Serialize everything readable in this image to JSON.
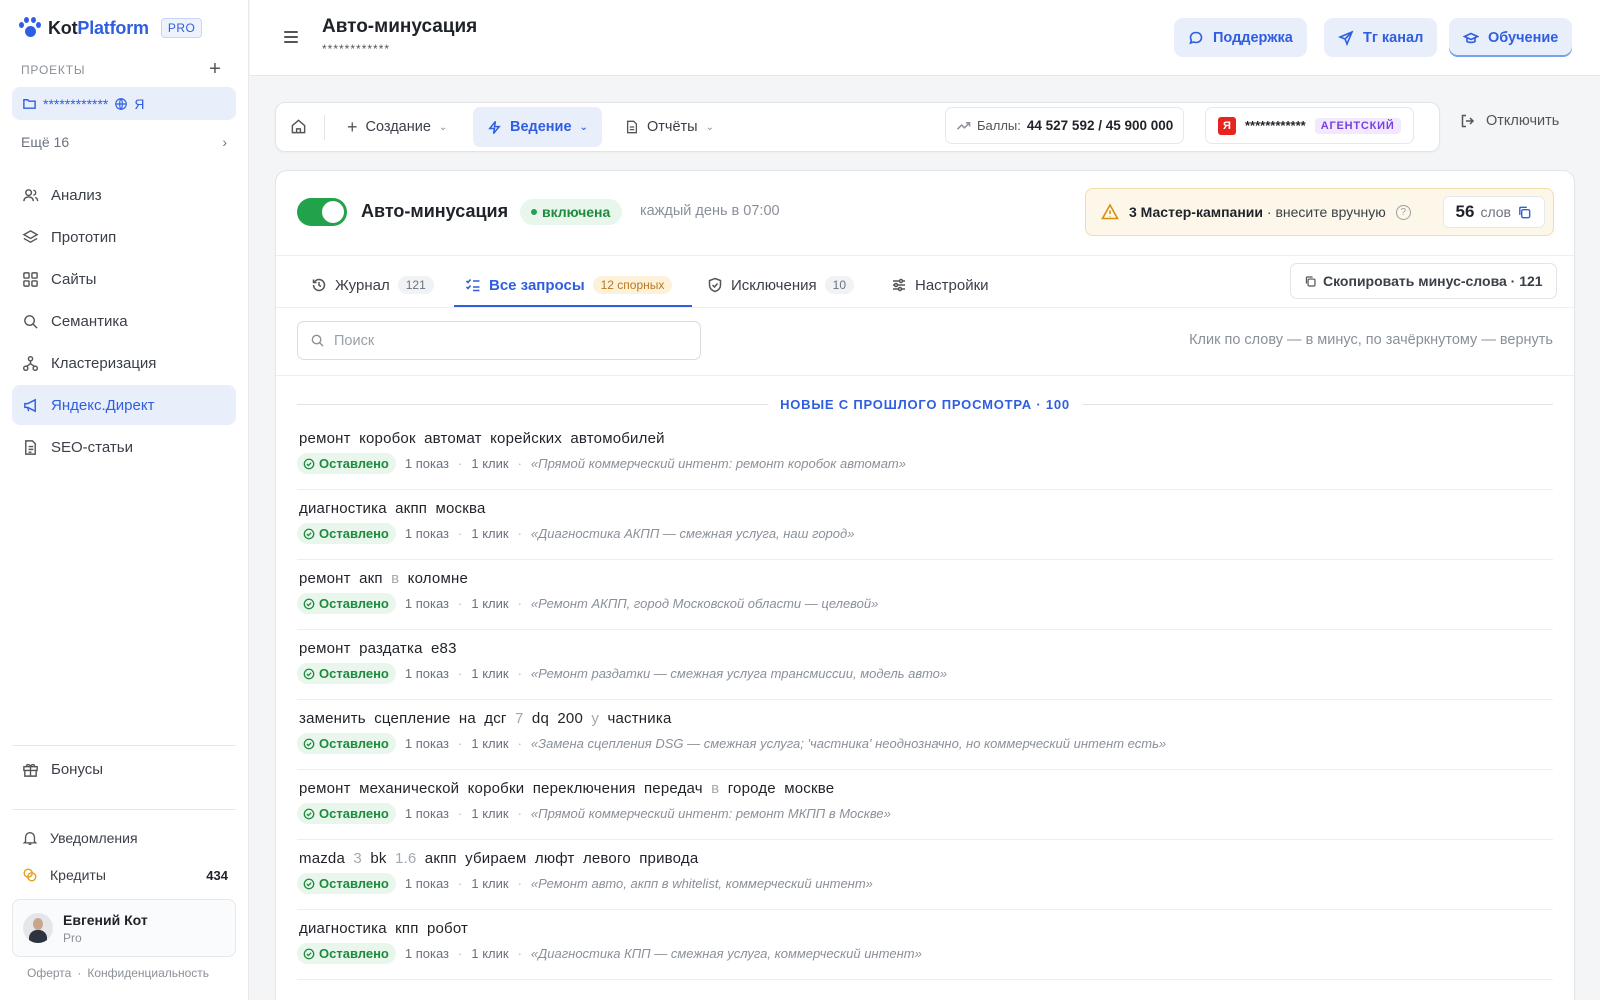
{
  "brand": {
    "name_part1": "Kot",
    "name_part2": "Platform",
    "badge": "PRO",
    "accent": "#2f5fe0"
  },
  "sidebar": {
    "section_label": "ПРОЕКТЫ",
    "add_symbol": "+",
    "project": {
      "name": "************",
      "suffix": "Я"
    },
    "more_label": "Ещё 16",
    "items": [
      {
        "label": "Анализ",
        "icon": "users-icon"
      },
      {
        "label": "Прототип",
        "icon": "layers-icon"
      },
      {
        "label": "Сайты",
        "icon": "grid-icon"
      },
      {
        "label": "Семантика",
        "icon": "search-icon"
      },
      {
        "label": "Кластеризация",
        "icon": "cluster-icon"
      },
      {
        "label": "Яндекс.Директ",
        "icon": "megaphone-icon",
        "active": true
      },
      {
        "label": "SEO-статьи",
        "icon": "document-icon"
      }
    ],
    "bonuses": "Бонусы",
    "notifications": "Уведомления",
    "credits_label": "Кредиты",
    "credits_count": "434",
    "user": {
      "name": "Евгений Кот",
      "plan": "Pro"
    },
    "legal": {
      "offer": "Оферта",
      "sep": "·",
      "privacy": "Конфиденциальность"
    }
  },
  "topbar": {
    "title": "Авто-минусация",
    "subtitle": "************",
    "buttons": {
      "support": "Поддержка",
      "telegram": "Тг канал",
      "learning": "Обучение"
    }
  },
  "toolbar": {
    "create": "Создание",
    "manage": "Ведение",
    "reports": "Отчёты",
    "points_label": "Баллы:",
    "points_value": "44 527 592 / 45 900 000",
    "account_name": "************",
    "account_badge": "АГЕНТСКИЙ",
    "ya_letter": "Я",
    "disconnect": "Отключить"
  },
  "feature": {
    "title": "Авто-минусация",
    "status": "включена",
    "schedule": "каждый день в 07:00",
    "warning_bold": "3 Мастер-кампании",
    "warning_rest": " · внесите вручную",
    "words_count": "56",
    "words_label": "слов",
    "toggle_on": true
  },
  "tabs": [
    {
      "label": "Журнал",
      "count": "121"
    },
    {
      "label": "Все запросы",
      "count": "12 спорных",
      "active": true
    },
    {
      "label": "Исключения",
      "count": "10"
    },
    {
      "label": "Настройки",
      "count": ""
    }
  ],
  "copy_button": "Скопировать минус-слова · 121",
  "search": {
    "placeholder": "Поиск"
  },
  "hint": "Клик по слову — в минус, по зачёркнутому — вернуть",
  "new_separator": "НОВЫЕ С ПРОШЛОГО ПРОСМОТРА · 100",
  "rows": [
    {
      "words": [
        [
          "ремонт",
          0
        ],
        [
          "коробок",
          0
        ],
        [
          "автомат",
          0
        ],
        [
          "корейских",
          0
        ],
        [
          "автомобилей",
          0
        ]
      ],
      "status": "Оставлено",
      "shows": "1 показ",
      "clicks": "1 клик",
      "reason": "«Прямой коммерческий интент: ремонт коробок автомат»"
    },
    {
      "words": [
        [
          "диагностика",
          0
        ],
        [
          "акпп",
          0
        ],
        [
          "москва",
          0
        ]
      ],
      "status": "Оставлено",
      "shows": "1 показ",
      "clicks": "1 клик",
      "reason": "«Диагностика АКПП — смежная услуга, наш город»"
    },
    {
      "words": [
        [
          "ремонт",
          0
        ],
        [
          "акп",
          0
        ],
        [
          "в",
          1
        ],
        [
          "коломне",
          0
        ]
      ],
      "status": "Оставлено",
      "shows": "1 показ",
      "clicks": "1 клик",
      "reason": "«Ремонт АКПП, город Московской области — целевой»"
    },
    {
      "words": [
        [
          "ремонт",
          0
        ],
        [
          "раздатка",
          0
        ],
        [
          "е83",
          0
        ]
      ],
      "status": "Оставлено",
      "shows": "1 показ",
      "clicks": "1 клик",
      "reason": "«Ремонт раздатки — смежная услуга трансмиссии, модель авто»"
    },
    {
      "words": [
        [
          "заменить",
          0
        ],
        [
          "сцепление",
          0
        ],
        [
          "на",
          0
        ],
        [
          "дсг",
          0
        ],
        [
          "7",
          1
        ],
        [
          "dq",
          0
        ],
        [
          "200",
          0
        ],
        [
          "у",
          1
        ],
        [
          "частника",
          0
        ]
      ],
      "status": "Оставлено",
      "shows": "1 показ",
      "clicks": "1 клик",
      "reason": "«Замена сцепления DSG — смежная услуга; 'частника' неоднозначно, но коммерческий интент есть»"
    },
    {
      "words": [
        [
          "ремонт",
          0
        ],
        [
          "механической",
          0
        ],
        [
          "коробки",
          0
        ],
        [
          "переключения",
          0
        ],
        [
          "передач",
          0
        ],
        [
          "в",
          1
        ],
        [
          "городе",
          0
        ],
        [
          "москве",
          0
        ]
      ],
      "status": "Оставлено",
      "shows": "1 показ",
      "clicks": "1 клик",
      "reason": "«Прямой коммерческий интент: ремонт МКПП в Москве»"
    },
    {
      "words": [
        [
          "mazda",
          0
        ],
        [
          "3",
          1
        ],
        [
          "bk",
          0
        ],
        [
          "1.6",
          1
        ],
        [
          "акпп",
          0
        ],
        [
          "убираем",
          0
        ],
        [
          "люфт",
          0
        ],
        [
          "левого",
          0
        ],
        [
          "привода",
          0
        ]
      ],
      "status": "Оставлено",
      "shows": "1 показ",
      "clicks": "1 клик",
      "reason": "«Ремонт авто, акпп в whitelist, коммерческий интент»"
    },
    {
      "words": [
        [
          "диагностика",
          0
        ],
        [
          "кпп",
          0
        ],
        [
          "робот",
          0
        ]
      ],
      "status": "Оставлено",
      "shows": "1 показ",
      "clicks": "1 клик",
      "reason": "«Диагностика КПП — смежная услуга, коммерческий интент»"
    }
  ]
}
